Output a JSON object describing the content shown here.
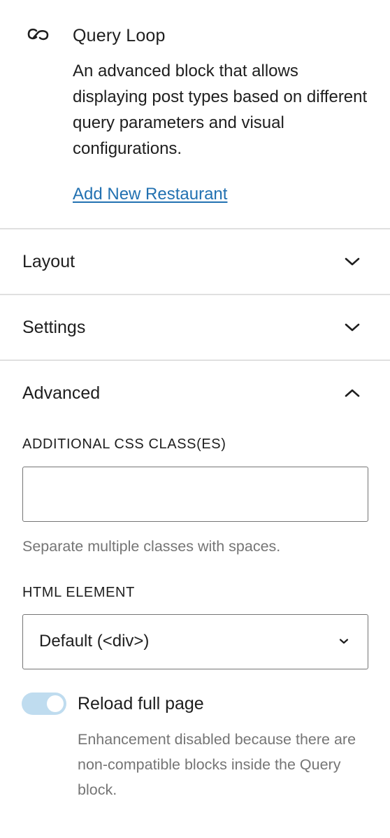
{
  "block_card": {
    "icon": "query-loop-icon",
    "title": "Query Loop",
    "description": "An advanced block that allows displaying post types based on different query parameters and visual configurations.",
    "link_label": "Add New Restaurant"
  },
  "panels": {
    "layout": {
      "title": "Layout",
      "expanded": false,
      "icon": "chevron-down-icon"
    },
    "settings": {
      "title": "Settings",
      "expanded": false,
      "icon": "chevron-down-icon"
    },
    "advanced": {
      "title": "Advanced",
      "expanded": true,
      "icon": "chevron-up-icon"
    }
  },
  "advanced": {
    "css_class_label": "ADDITIONAL CSS CLASS(ES)",
    "css_class_value": "",
    "css_class_help": "Separate multiple classes with spaces.",
    "html_element_label": "HTML ELEMENT",
    "html_element_value": "Default (<div>)",
    "reload_label": "Reload full page",
    "reload_enabled": true,
    "reload_help": "Enhancement disabled because there are non-compatible blocks inside the Query block."
  },
  "colors": {
    "link": "#2271b1",
    "text": "#1e1e1e",
    "muted": "#757575",
    "divider": "#e0e0e0",
    "toggle_track_disabled": "#bfdcef"
  }
}
